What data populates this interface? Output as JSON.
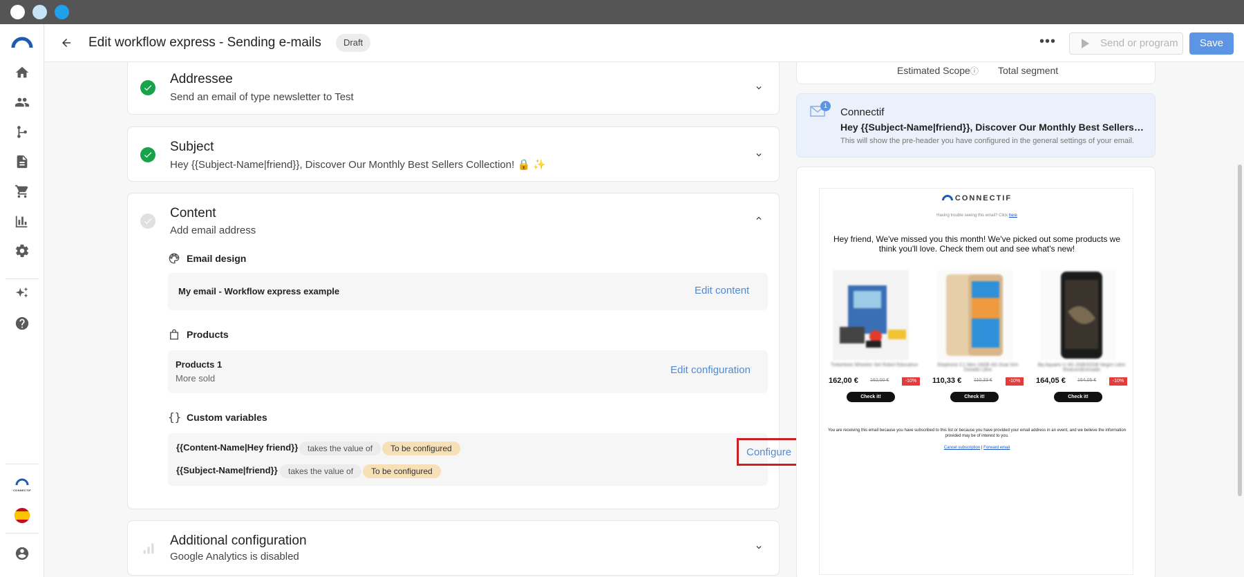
{
  "header": {
    "title": "Edit workflow express - Sending e-mails",
    "status_badge": "Draft",
    "more_label": "•••",
    "send_label": "Send or program",
    "save_label": "Save"
  },
  "steps": {
    "addressee": {
      "title": "Addressee",
      "subtitle": "Send an email of type newsletter to Test"
    },
    "subject": {
      "title": "Subject",
      "subtitle": "Hey {{Subject-Name|friend}}, Discover Our Monthly Best Sellers Collection! 🔒 ✨"
    },
    "content": {
      "title": "Content",
      "subtitle": "Add email address",
      "email_design": {
        "label": "Email design",
        "name": "My email - Workflow express example",
        "action": "Edit content"
      },
      "products": {
        "label": "Products",
        "name": "Products 1",
        "detail": "More sold",
        "action": "Edit configuration"
      },
      "custom_variables": {
        "label": "Custom variables",
        "icon": "{}",
        "items": [
          {
            "name": "{{Content-Name|Hey friend}}",
            "relation": "takes the value of",
            "status": "To be configured"
          },
          {
            "name": "{{Subject-Name|friend}}",
            "relation": "takes the value of",
            "status": "To be configured"
          }
        ],
        "action": "Configure"
      }
    },
    "additional": {
      "title": "Additional configuration",
      "subtitle": "Google Analytics is disabled"
    }
  },
  "scope": {
    "estimated_label": "Estimated Scope",
    "info_icon": "ⓘ",
    "segment_label": "Total segment"
  },
  "preview": {
    "badge_count": "1",
    "sender": "Connectif",
    "subject": "Hey {{Subject-Name|friend}}, Discover Our Monthly Best Sellers Collection! 🔒 ✨",
    "note": "This will show the pre-header you have configured in the general settings of your email.",
    "email": {
      "logo": "CONNECTIF",
      "trouble_text": "Having trouble seeing this email? Click",
      "trouble_link": "here",
      "greeting": "Hey friend, We've missed you this month! We've picked out some products we think you'll love. Check them out and see what's new!",
      "products": [
        {
          "name": "Tinkerbots Wheeler Set Robot Educativo",
          "price": "162,00 €",
          "old_price": "162,00 €",
          "discount": "-10%",
          "button": "Check it!"
        },
        {
          "name": "Elephone C1 Mini 16GB 4G Dual Sim Dorado Libre",
          "price": "110,33 €",
          "old_price": "110,33 €",
          "discount": "-10%",
          "button": "Check it!"
        },
        {
          "name": "Bq Aquaris U 4G 2GB/32GB Negro Libre Reacondicionado",
          "price": "164,05 €",
          "old_price": "164,05 €",
          "discount": "-10%",
          "button": "Check it!"
        }
      ],
      "footer": "You are receiving this email because you have subscribed to this list or because you have provided your email address in an event, and we believe the information provided may be of interest to you.",
      "cancel_link": "Cancel subscription",
      "separator": "|",
      "forward_link": "Forward email"
    }
  },
  "sidebar": {
    "items": [
      "home-icon",
      "contacts-icon",
      "workflows-icon",
      "content-icon",
      "cart-icon",
      "reports-icon",
      "settings-icon",
      "ai-sparkle-icon",
      "help-icon",
      "account-icon"
    ],
    "mini_logo": "CONNECTIF"
  },
  "colors": {
    "accent": "#5c95e3",
    "success": "#18a34a",
    "highlight": "#cc1f1f",
    "pending": "#f7dfb6"
  }
}
